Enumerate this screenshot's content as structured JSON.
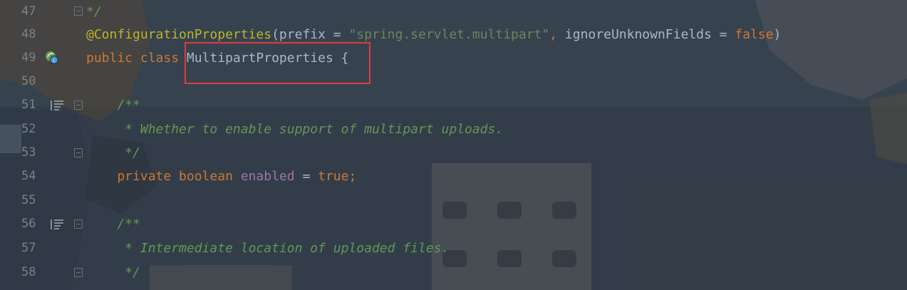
{
  "editor": {
    "lines": [
      {
        "num": "47",
        "tokens": [
          {
            "t": "*/",
            "c": "doc"
          }
        ]
      },
      {
        "num": "48",
        "tokens": [
          {
            "t": "@ConfigurationProperties",
            "c": "ann"
          },
          {
            "t": "(prefix = ",
            "c": "plain"
          },
          {
            "t": "\"spring.servlet.multipart\"",
            "c": "str"
          },
          {
            "t": ", ",
            "c": "kw"
          },
          {
            "t": "ignoreUnknownFields = ",
            "c": "plain"
          },
          {
            "t": "false",
            "c": "kw"
          },
          {
            "t": ")",
            "c": "plain"
          }
        ]
      },
      {
        "num": "49",
        "tokens": [
          {
            "t": "public class ",
            "c": "kw"
          },
          {
            "t": "MultipartProperties",
            "c": "plain"
          },
          {
            "t": " {",
            "c": "plain"
          }
        ]
      },
      {
        "num": "50",
        "tokens": []
      },
      {
        "num": "51",
        "tokens": [
          {
            "t": "    /**",
            "c": "doc"
          }
        ]
      },
      {
        "num": "52",
        "tokens": [
          {
            "t": "     * Whether to enable support of multipart uploads.",
            "c": "doc"
          }
        ]
      },
      {
        "num": "53",
        "tokens": [
          {
            "t": "     */",
            "c": "doc"
          }
        ]
      },
      {
        "num": "54",
        "tokens": [
          {
            "t": "    private boolean ",
            "c": "kw"
          },
          {
            "t": "enabled",
            "c": "field"
          },
          {
            "t": " = ",
            "c": "plain"
          },
          {
            "t": "true",
            "c": "kw"
          },
          {
            "t": ";",
            "c": "kw"
          }
        ]
      },
      {
        "num": "55",
        "tokens": []
      },
      {
        "num": "56",
        "tokens": [
          {
            "t": "    /**",
            "c": "doc"
          }
        ]
      },
      {
        "num": "57",
        "tokens": [
          {
            "t": "     * Intermediate location of uploaded files.",
            "c": "doc"
          }
        ]
      },
      {
        "num": "58",
        "tokens": [
          {
            "t": "     */",
            "c": "doc"
          }
        ]
      }
    ],
    "gutter_icons": {
      "47": "fold-end-icon",
      "49": "spring-bean-icon",
      "51": "rendered-doc-icon",
      "53": "fold-end-icon",
      "56": "rendered-doc-icon"
    },
    "highlight_target": "MultipartProperties"
  },
  "colors": {
    "keyword": "#cc7832",
    "annotation": "#bbb529",
    "string": "#6a8759",
    "doc_comment": "#629755",
    "field": "#9876aa",
    "plain": "#a9b7c6",
    "line_number": "#7b8187",
    "highlight_box": "#e23b3b"
  }
}
